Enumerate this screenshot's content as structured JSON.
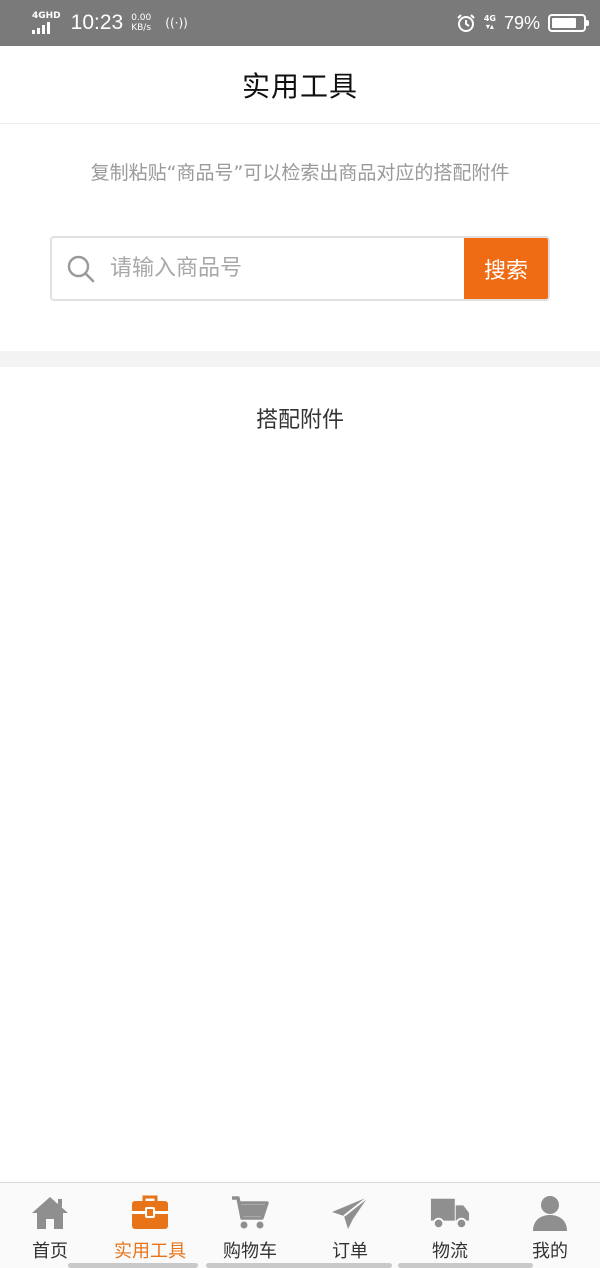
{
  "status_bar": {
    "network": "4GHD",
    "time": "10:23",
    "speed_value": "0.00",
    "speed_unit": "KB/s",
    "hotspot": "((·))",
    "net_right": "4G",
    "battery_percent": "79%",
    "battery_level": 0.79
  },
  "header": {
    "title": "实用工具"
  },
  "hint": {
    "text": "复制粘贴“商品号”可以检索出商品对应的搭配附件"
  },
  "search": {
    "placeholder": "请输入商品号",
    "value": "",
    "button_label": "搜索"
  },
  "section": {
    "title": "搭配附件"
  },
  "tabbar": {
    "items": [
      {
        "label": "首页",
        "icon": "home-icon"
      },
      {
        "label": "实用工具",
        "icon": "toolbox-icon",
        "active": true
      },
      {
        "label": "购物车",
        "icon": "cart-icon"
      },
      {
        "label": "订单",
        "icon": "paper-plane-icon"
      },
      {
        "label": "物流",
        "icon": "truck-icon"
      },
      {
        "label": "我的",
        "icon": "user-icon"
      }
    ],
    "active_color": "#e8741a",
    "inactive_icon_color": "#8f8f8f"
  },
  "colors": {
    "accent": "#ef6c14",
    "status_bar_bg": "#7a7a7a"
  }
}
